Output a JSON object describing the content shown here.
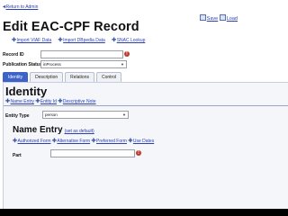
{
  "nav": {
    "return_label": "Return to Admin"
  },
  "toolbar": {
    "save_label": "Save",
    "load_label": "Load"
  },
  "page": {
    "title": "Edit EAC-CPF Record"
  },
  "imports": [
    {
      "label": "Import VIAF Data"
    },
    {
      "label": "Import DBpedia Data"
    },
    {
      "label": "SNAC Lookup"
    }
  ],
  "record": {
    "label": "Record ID",
    "value": ""
  },
  "publication": {
    "label": "Publication Status",
    "selected": "inProcess"
  },
  "tabs": [
    {
      "label": "Identity",
      "active": true
    },
    {
      "label": "Description",
      "active": false
    },
    {
      "label": "Relations",
      "active": false
    },
    {
      "label": "Control",
      "active": false
    }
  ],
  "identity": {
    "heading": "Identity",
    "links": [
      {
        "label": "Name Entry"
      },
      {
        "label": "Entity Id"
      },
      {
        "label": "Descriptive Note"
      }
    ],
    "entity_type": {
      "label": "Entity Type",
      "selected": "person"
    }
  },
  "name_entry": {
    "heading": "Name Entry",
    "subtitle": "(set as default)",
    "links": [
      {
        "label": "Authorized Form"
      },
      {
        "label": "Alternative Form"
      },
      {
        "label": "Preferred Form"
      },
      {
        "label": "Use Dates"
      }
    ],
    "part_label": "Part",
    "part_value": ""
  },
  "colors": {
    "accent": "#3d63c8",
    "error": "#c0392b",
    "link": "#2b3fb0"
  }
}
